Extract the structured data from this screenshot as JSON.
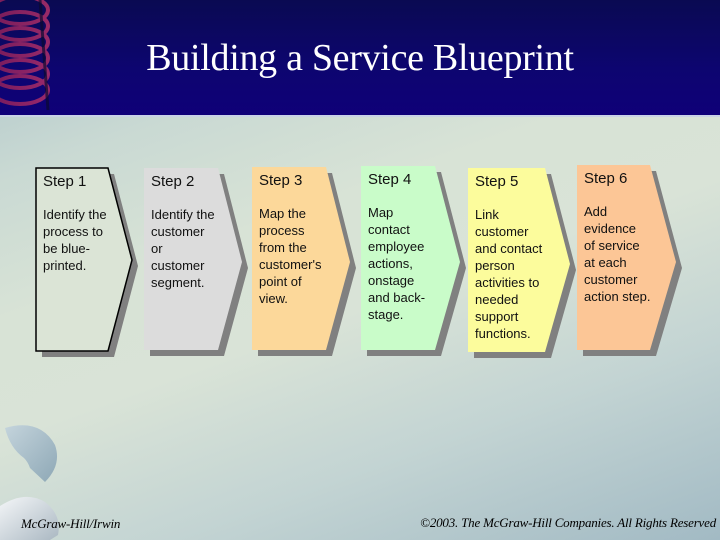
{
  "slide": {
    "title": "Building a Service Blueprint",
    "footer_left": "McGraw-Hill/Irwin",
    "footer_right": "©2003. The McGraw-Hill Companies. All Rights Reserved"
  },
  "colors": {
    "header_bg": "#0d0570",
    "title_text": "#ffffff",
    "shadow": "#808080"
  },
  "steps": [
    {
      "label": "Step 1",
      "description": "Identify the\nprocess to\nbe blue-\nprinted.",
      "fill": "#dbe4d6",
      "outlined": true
    },
    {
      "label": "Step 2",
      "description": "Identify the\ncustomer\nor\ncustomer\nsegment.",
      "fill": "#dcdcdc",
      "outlined": false
    },
    {
      "label": "Step 3",
      "description": "Map the\nprocess\nfrom the\ncustomer's\npoint of\nview.",
      "fill": "#fcd89a",
      "outlined": false
    },
    {
      "label": "Step 4",
      "description": "Map\ncontact\nemployee\nactions,\nonstage\nand back-\nstage.",
      "fill": "#c9fcc9",
      "outlined": false
    },
    {
      "label": "Step 5",
      "description": "Link\ncustomer\nand contact\nperson\nactivities to\nneeded\nsupport\nfunctions.",
      "fill": "#fcfc9c",
      "outlined": false
    },
    {
      "label": "Step 6",
      "description": "Add\nevidence\nof service\nat each\ncustomer\naction step.",
      "fill": "#fcc696",
      "outlined": false
    }
  ]
}
